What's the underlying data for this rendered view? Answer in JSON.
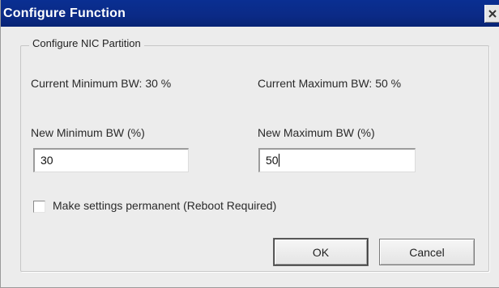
{
  "window": {
    "title": "Configure Function",
    "close_glyph": "×",
    "close_icon": "close-icon"
  },
  "group": {
    "legend": "Configure NIC Partition"
  },
  "current": {
    "min_label": "Current Minimum BW: 30 %",
    "max_label": "Current Maximum BW: 50 %"
  },
  "new_min": {
    "label": "New Minimum BW (%)",
    "value": "30"
  },
  "new_max": {
    "label": "New Maximum BW (%)",
    "value": "50"
  },
  "permanent": {
    "label": "Make settings permanent (Reboot Required)",
    "checked": false
  },
  "buttons": {
    "ok": "OK",
    "cancel": "Cancel"
  },
  "colors": {
    "titlebar": "#0b2a86",
    "window_bg": "#ececec"
  }
}
